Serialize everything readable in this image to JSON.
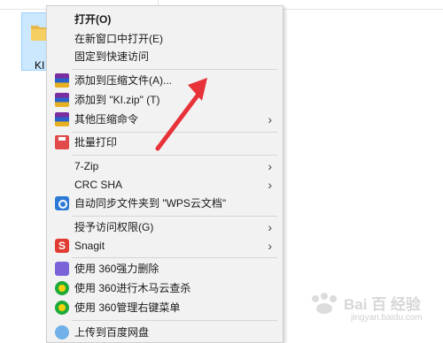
{
  "desktop": {
    "folder_label": "KI"
  },
  "menu": {
    "items": [
      {
        "label": "打开(O)",
        "bold": true,
        "icon": ""
      },
      {
        "label": "在新窗口中打开(E)",
        "icon": ""
      },
      {
        "label": "固定到快速访问",
        "icon": ""
      },
      {
        "label": "添加到压缩文件(A)...",
        "icon": "winrar-icon"
      },
      {
        "label": "添加到 \"KI.zip\" (T)",
        "icon": "winrar-icon"
      },
      {
        "label": "其他压缩命令",
        "icon": "winrar-icon",
        "submenu": true
      },
      {
        "label": "批量打印",
        "icon": "printer-icon"
      },
      {
        "label": "7-Zip",
        "icon": "",
        "submenu": true
      },
      {
        "label": "CRC SHA",
        "icon": "",
        "submenu": true
      },
      {
        "label": "自动同步文件夹到 \"WPS云文档\"",
        "icon": "wps-cloud-icon"
      },
      {
        "label": "授予访问权限(G)",
        "icon": "",
        "submenu": true
      },
      {
        "label": "Snagit",
        "icon": "snagit-icon",
        "submenu": true
      },
      {
        "label": "使用 360强力删除",
        "icon": "shredder-icon"
      },
      {
        "label": "使用 360进行木马云查杀",
        "icon": "360-icon"
      },
      {
        "label": "使用 360管理右键菜单",
        "icon": "360-icon"
      },
      {
        "label": "上传到百度网盘",
        "icon": "baidu-cloud-icon"
      }
    ],
    "submenu_glyph": "›",
    "snagit_glyph": "S"
  },
  "annotation": {
    "arrow_color": "#e8323a"
  },
  "watermark": {
    "text": "Bai 百 经验",
    "url": "jingyan.baidu.com"
  }
}
